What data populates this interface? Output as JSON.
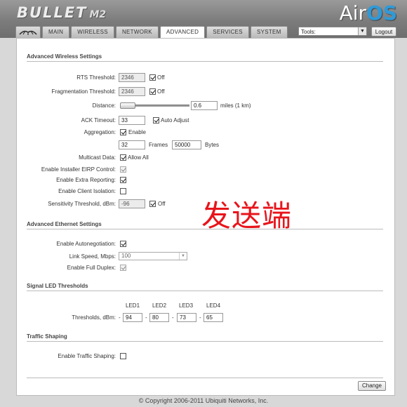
{
  "header": {
    "product_name": "BULLET",
    "product_model": "M2",
    "airos_prefix": "Air",
    "airos_suffix": "OS"
  },
  "tabs": [
    {
      "label": "MAIN"
    },
    {
      "label": "WIRELESS"
    },
    {
      "label": "NETWORK"
    },
    {
      "label": "ADVANCED",
      "active": true
    },
    {
      "label": "SERVICES"
    },
    {
      "label": "SYSTEM"
    }
  ],
  "tools": {
    "selected": "Tools:"
  },
  "logout_label": "Logout",
  "advanced_wireless": {
    "title": "Advanced Wireless Settings",
    "rts": {
      "label": "RTS Threshold:",
      "value": "2346",
      "off_label": "Off",
      "off_checked": true
    },
    "frag": {
      "label": "Fragmentation Threshold:",
      "value": "2346",
      "off_label": "Off",
      "off_checked": true
    },
    "distance": {
      "label": "Distance:",
      "value": "0.6",
      "unit": "miles (1 km)"
    },
    "ack": {
      "label": "ACK Timeout:",
      "value": "33",
      "auto_label": "Auto Adjust",
      "auto_checked": true
    },
    "aggregation": {
      "label": "Aggregation:",
      "enable_label": "Enable",
      "enabled": true,
      "frames": "32",
      "frames_label": "Frames",
      "bytes": "50000",
      "bytes_label": "Bytes"
    },
    "multicast": {
      "label": "Multicast Data:",
      "allow_label": "Allow All",
      "checked": true
    },
    "eirp": {
      "label": "Enable Installer EIRP Control:",
      "checked": true,
      "disabled": true
    },
    "extra_reporting": {
      "label": "Enable Extra Reporting:",
      "checked": true
    },
    "client_isolation": {
      "label": "Enable Client Isolation:",
      "checked": false
    },
    "sensitivity": {
      "label": "Sensitivity Threshold, dBm:",
      "value": "-96",
      "off_label": "Off",
      "off_checked": true
    }
  },
  "overlay_text": "发送端",
  "advanced_ethernet": {
    "title": "Advanced Ethernet Settings",
    "autoneg": {
      "label": "Enable Autonegotiation:",
      "checked": true
    },
    "link_speed": {
      "label": "Link Speed, Mbps:",
      "value": "100"
    },
    "full_duplex": {
      "label": "Enable Full Duplex:",
      "checked": true,
      "disabled": true
    }
  },
  "signal_led": {
    "title": "Signal LED Thresholds",
    "label": "Thresholds, dBm:",
    "leds": [
      {
        "name": "LED1",
        "value": "94"
      },
      {
        "name": "LED2",
        "value": "80"
      },
      {
        "name": "LED3",
        "value": "73"
      },
      {
        "name": "LED4",
        "value": "65"
      }
    ],
    "separator": "-"
  },
  "traffic_shaping": {
    "title": "Traffic Shaping",
    "enable": {
      "label": "Enable Traffic Shaping:",
      "checked": false
    }
  },
  "change_label": "Change",
  "footer_text": "© Copyright 2006-2011 Ubiquiti Networks, Inc.",
  "colors": {
    "accent": "#2f9ad8",
    "overlay": "#e8141b"
  }
}
